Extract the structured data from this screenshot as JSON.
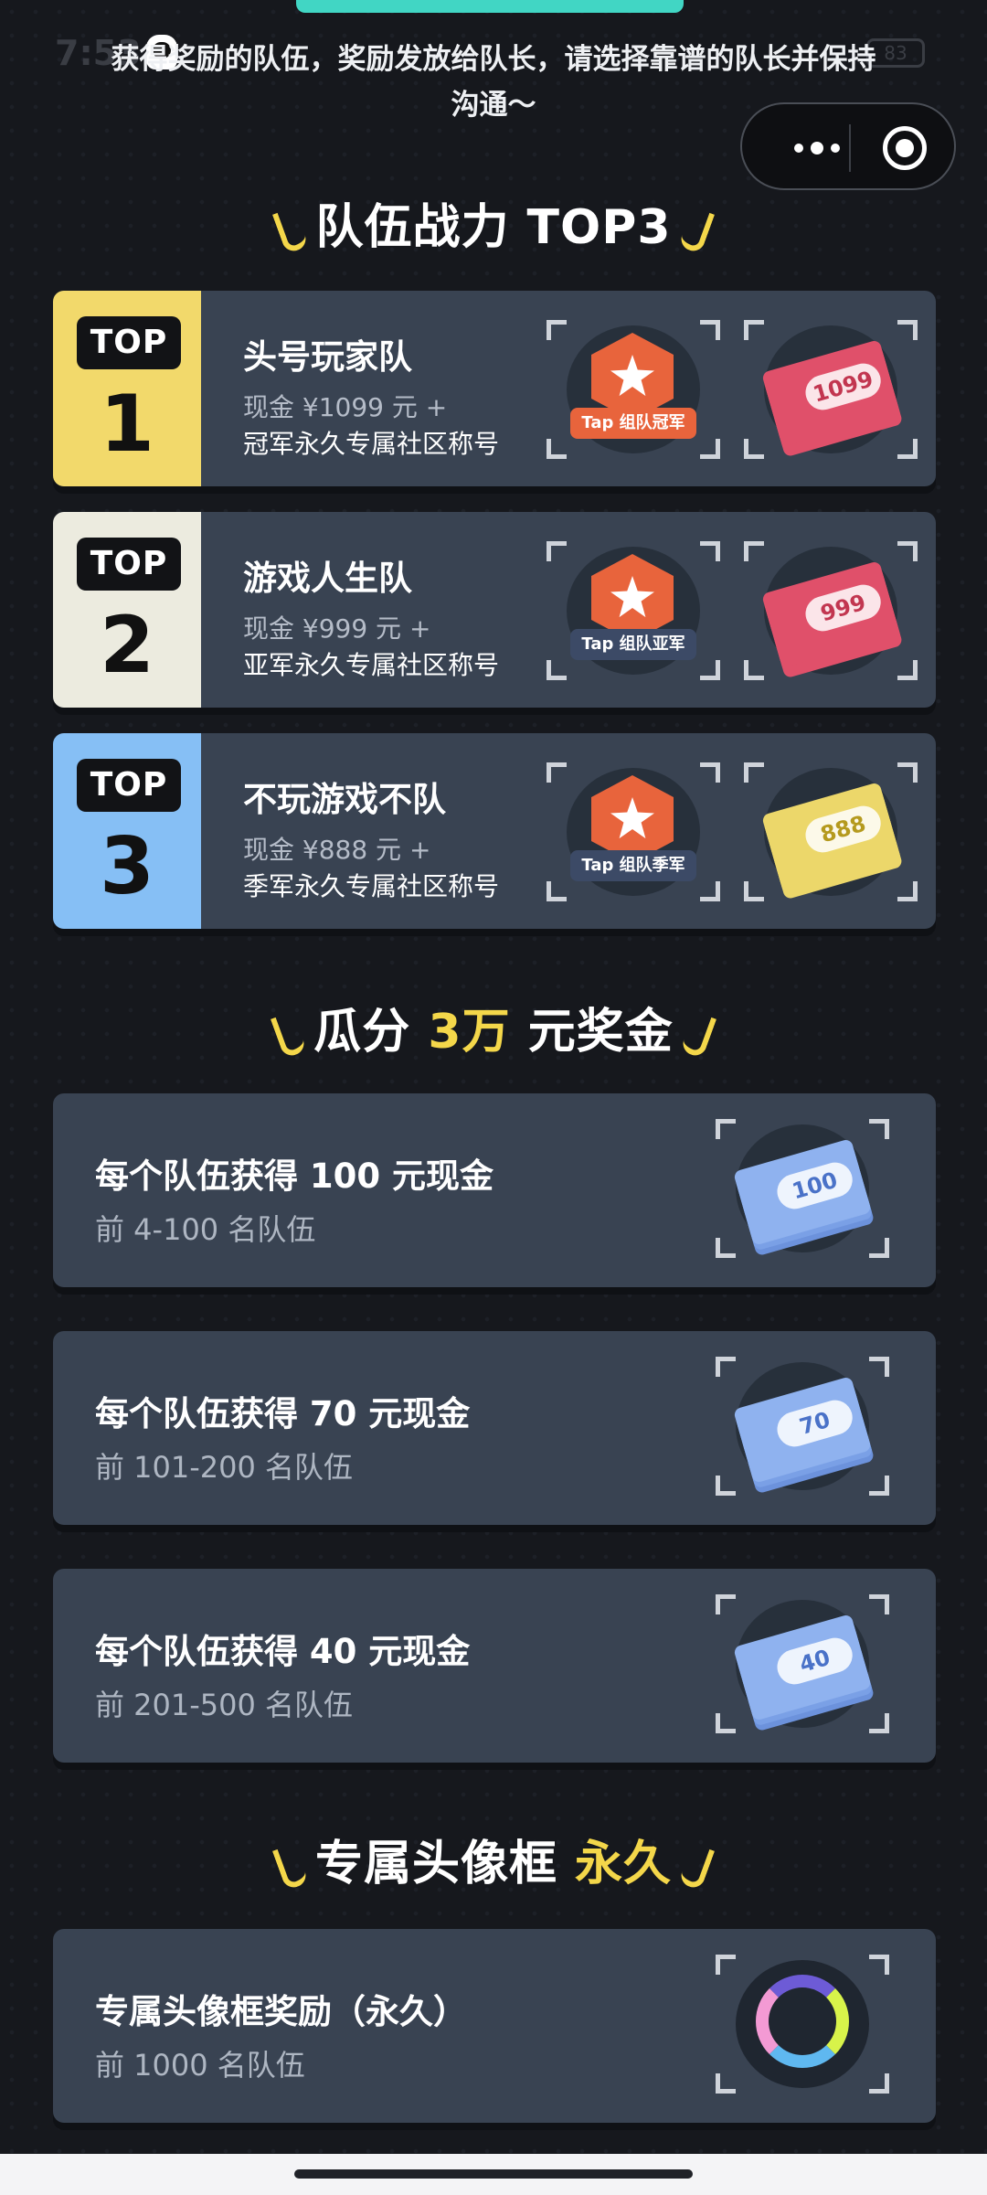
{
  "status": {
    "time": "7:53",
    "battery": "83"
  },
  "notice": "获得奖励的队伍，奖励发放给队长，请选择靠谱的队长并保持沟通～",
  "sections": {
    "top3_title": "队伍战力 TOP3",
    "split_title_a": "瓜分 ",
    "split_title_hl": "3万",
    "split_title_b": " 元奖金",
    "frame_title_a": "专属头像框 ",
    "frame_title_hl": "永久"
  },
  "top_teams": [
    {
      "tag": "TOP",
      "rank": "1",
      "name": "头号玩家队",
      "prize": "现金 ¥1099 元 +",
      "title": "冠军永久专属社区称号",
      "badge": "Tap 组队冠军",
      "cash": "1099",
      "color": "#f2d96b"
    },
    {
      "tag": "TOP",
      "rank": "2",
      "name": "游戏人生队",
      "prize": "现金 ¥999 元 +",
      "title": "亚军永久专属社区称号",
      "badge": "Tap 组队亚军",
      "cash": "999",
      "color": "#ecebdf"
    },
    {
      "tag": "TOP",
      "rank": "3",
      "name": "不玩游戏不队",
      "prize": "现金 ¥888 元 +",
      "title": "季军永久专属社区称号",
      "badge": "Tap 组队季军",
      "cash": "888",
      "color": "#86bff5"
    }
  ],
  "cash_prizes": [
    {
      "title": "每个队伍获得 100 元现金",
      "subtitle": "前 4-100 名队伍",
      "cash": "100"
    },
    {
      "title": "每个队伍获得 70 元现金",
      "subtitle": "前 101-200 名队伍",
      "cash": "70"
    },
    {
      "title": "每个队伍获得 40 元现金",
      "subtitle": "前 201-500 名队伍",
      "cash": "40"
    }
  ],
  "frame_prize": {
    "title": "专属头像框奖励（永久）",
    "subtitle": "前 1000 名队伍"
  }
}
